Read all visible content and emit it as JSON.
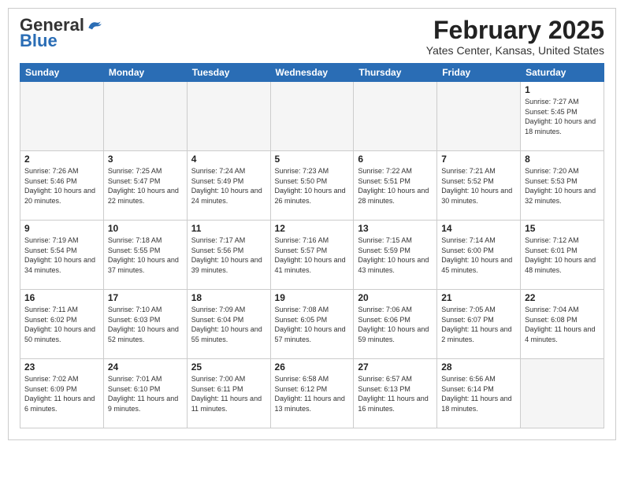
{
  "header": {
    "logo_general": "General",
    "logo_blue": "Blue",
    "month_title": "February 2025",
    "location": "Yates Center, Kansas, United States"
  },
  "weekdays": [
    "Sunday",
    "Monday",
    "Tuesday",
    "Wednesday",
    "Thursday",
    "Friday",
    "Saturday"
  ],
  "weeks": [
    [
      {
        "day": "",
        "info": ""
      },
      {
        "day": "",
        "info": ""
      },
      {
        "day": "",
        "info": ""
      },
      {
        "day": "",
        "info": ""
      },
      {
        "day": "",
        "info": ""
      },
      {
        "day": "",
        "info": ""
      },
      {
        "day": "1",
        "info": "Sunrise: 7:27 AM\nSunset: 5:45 PM\nDaylight: 10 hours and 18 minutes."
      }
    ],
    [
      {
        "day": "2",
        "info": "Sunrise: 7:26 AM\nSunset: 5:46 PM\nDaylight: 10 hours and 20 minutes."
      },
      {
        "day": "3",
        "info": "Sunrise: 7:25 AM\nSunset: 5:47 PM\nDaylight: 10 hours and 22 minutes."
      },
      {
        "day": "4",
        "info": "Sunrise: 7:24 AM\nSunset: 5:49 PM\nDaylight: 10 hours and 24 minutes."
      },
      {
        "day": "5",
        "info": "Sunrise: 7:23 AM\nSunset: 5:50 PM\nDaylight: 10 hours and 26 minutes."
      },
      {
        "day": "6",
        "info": "Sunrise: 7:22 AM\nSunset: 5:51 PM\nDaylight: 10 hours and 28 minutes."
      },
      {
        "day": "7",
        "info": "Sunrise: 7:21 AM\nSunset: 5:52 PM\nDaylight: 10 hours and 30 minutes."
      },
      {
        "day": "8",
        "info": "Sunrise: 7:20 AM\nSunset: 5:53 PM\nDaylight: 10 hours and 32 minutes."
      }
    ],
    [
      {
        "day": "9",
        "info": "Sunrise: 7:19 AM\nSunset: 5:54 PM\nDaylight: 10 hours and 34 minutes."
      },
      {
        "day": "10",
        "info": "Sunrise: 7:18 AM\nSunset: 5:55 PM\nDaylight: 10 hours and 37 minutes."
      },
      {
        "day": "11",
        "info": "Sunrise: 7:17 AM\nSunset: 5:56 PM\nDaylight: 10 hours and 39 minutes."
      },
      {
        "day": "12",
        "info": "Sunrise: 7:16 AM\nSunset: 5:57 PM\nDaylight: 10 hours and 41 minutes."
      },
      {
        "day": "13",
        "info": "Sunrise: 7:15 AM\nSunset: 5:59 PM\nDaylight: 10 hours and 43 minutes."
      },
      {
        "day": "14",
        "info": "Sunrise: 7:14 AM\nSunset: 6:00 PM\nDaylight: 10 hours and 45 minutes."
      },
      {
        "day": "15",
        "info": "Sunrise: 7:12 AM\nSunset: 6:01 PM\nDaylight: 10 hours and 48 minutes."
      }
    ],
    [
      {
        "day": "16",
        "info": "Sunrise: 7:11 AM\nSunset: 6:02 PM\nDaylight: 10 hours and 50 minutes."
      },
      {
        "day": "17",
        "info": "Sunrise: 7:10 AM\nSunset: 6:03 PM\nDaylight: 10 hours and 52 minutes."
      },
      {
        "day": "18",
        "info": "Sunrise: 7:09 AM\nSunset: 6:04 PM\nDaylight: 10 hours and 55 minutes."
      },
      {
        "day": "19",
        "info": "Sunrise: 7:08 AM\nSunset: 6:05 PM\nDaylight: 10 hours and 57 minutes."
      },
      {
        "day": "20",
        "info": "Sunrise: 7:06 AM\nSunset: 6:06 PM\nDaylight: 10 hours and 59 minutes."
      },
      {
        "day": "21",
        "info": "Sunrise: 7:05 AM\nSunset: 6:07 PM\nDaylight: 11 hours and 2 minutes."
      },
      {
        "day": "22",
        "info": "Sunrise: 7:04 AM\nSunset: 6:08 PM\nDaylight: 11 hours and 4 minutes."
      }
    ],
    [
      {
        "day": "23",
        "info": "Sunrise: 7:02 AM\nSunset: 6:09 PM\nDaylight: 11 hours and 6 minutes."
      },
      {
        "day": "24",
        "info": "Sunrise: 7:01 AM\nSunset: 6:10 PM\nDaylight: 11 hours and 9 minutes."
      },
      {
        "day": "25",
        "info": "Sunrise: 7:00 AM\nSunset: 6:11 PM\nDaylight: 11 hours and 11 minutes."
      },
      {
        "day": "26",
        "info": "Sunrise: 6:58 AM\nSunset: 6:12 PM\nDaylight: 11 hours and 13 minutes."
      },
      {
        "day": "27",
        "info": "Sunrise: 6:57 AM\nSunset: 6:13 PM\nDaylight: 11 hours and 16 minutes."
      },
      {
        "day": "28",
        "info": "Sunrise: 6:56 AM\nSunset: 6:14 PM\nDaylight: 11 hours and 18 minutes."
      },
      {
        "day": "",
        "info": ""
      }
    ]
  ]
}
